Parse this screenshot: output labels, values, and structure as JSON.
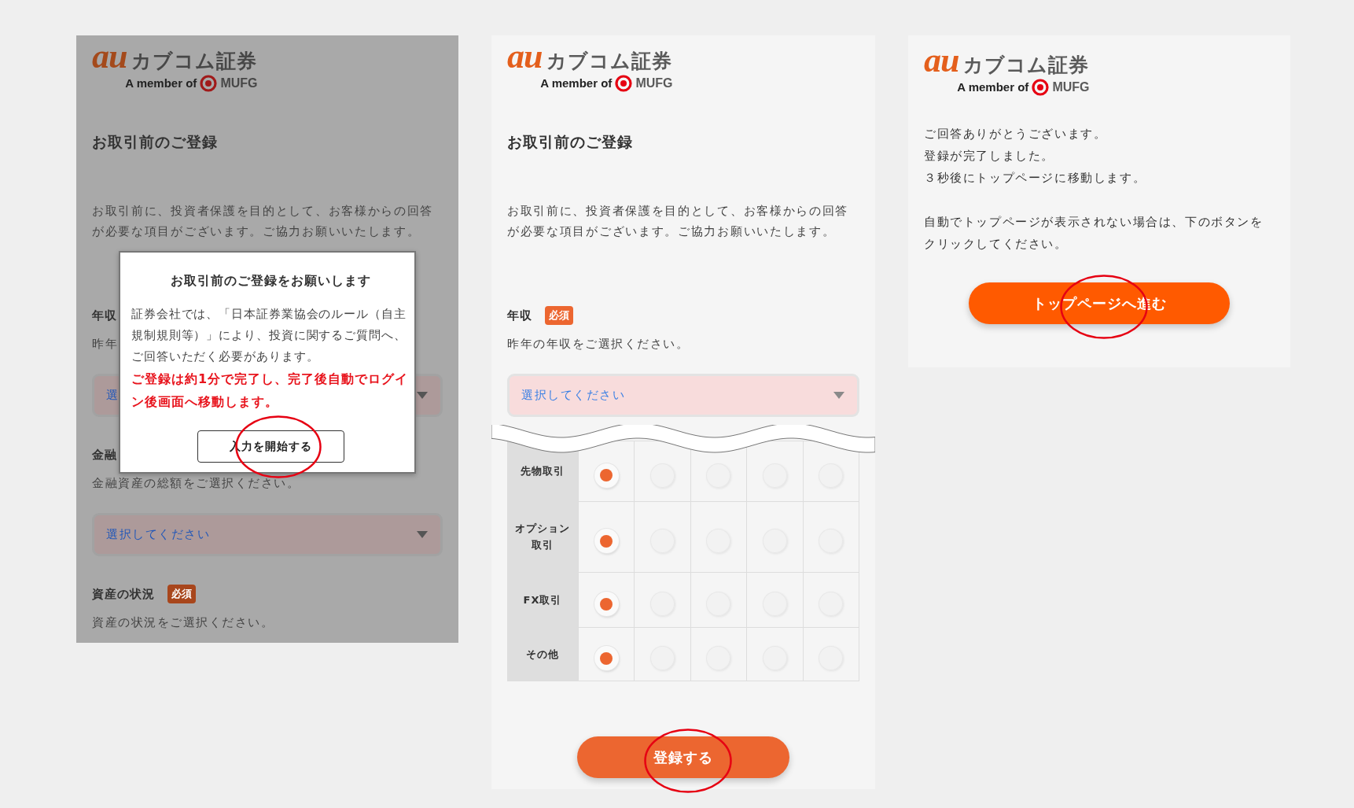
{
  "panels": [
    {
      "kind": "form",
      "dimmed": true,
      "logo": {
        "brand": "au",
        "name": "カブコム証券",
        "tagline": "A member of",
        "group": "MUFG"
      },
      "title": "お取引前のご登録",
      "description": "お取引前に、投資者保護を目的として、お客様からの回答が必要な項目がございます。ご協力お願いいたします。",
      "fields": [
        {
          "label": "年収",
          "hint": "昨年",
          "select": {
            "placeholder": "選"
          }
        },
        {
          "label": "金融",
          "hint": "金融資産の総額をご選択ください。",
          "select": {
            "placeholder": "選択してください"
          }
        },
        {
          "label": "資産の状況",
          "badge": "必須",
          "hint": "資産の状況をご選択ください。"
        }
      ],
      "dialog": {
        "title": "お取引前のご登録をお願いします",
        "body": "証券会社では、「日本証券業協会のルール（自主規制規則等）」により、投資に関するご質問へ、ご回答いただく必要があります。",
        "notice": "ご登録は約1分で完了し、完了後自動でログイン後画面へ移動します。",
        "button": {
          "label": "入力を開始する",
          "circled": true
        }
      }
    },
    {
      "kind": "form",
      "dimmed": false,
      "logo": {
        "brand": "au",
        "name": "カブコム証券",
        "tagline": "A member of",
        "group": "MUFG"
      },
      "title": "お取引前のご登録",
      "description": "お取引前に、投資者保護を目的として、お客様からの回答が必要な項目がございます。ご協力お願いいたします。",
      "fields": [
        {
          "label": "年収",
          "badge": "必須",
          "hint": "昨年の年収をご選択ください。",
          "select": {
            "placeholder": "選択してください"
          }
        }
      ],
      "matrix": {
        "rows": [
          {
            "label": "先物取引",
            "choices": [
              {
                "selected": true
              },
              {
                "selected": false
              },
              {
                "selected": false
              },
              {
                "selected": false
              },
              {
                "selected": false
              }
            ]
          },
          {
            "label": "オプション取引",
            "choices": [
              {
                "selected": true
              },
              {
                "selected": false
              },
              {
                "selected": false
              },
              {
                "selected": false
              },
              {
                "selected": false
              }
            ]
          },
          {
            "label": "FX取引",
            "choices": [
              {
                "selected": true
              },
              {
                "selected": false
              },
              {
                "selected": false
              },
              {
                "selected": false
              },
              {
                "selected": false
              }
            ]
          },
          {
            "label": "その他",
            "choices": [
              {
                "selected": true
              },
              {
                "selected": false
              },
              {
                "selected": false
              },
              {
                "selected": false
              },
              {
                "selected": false
              }
            ]
          }
        ]
      },
      "button": {
        "label": "登録する",
        "circled": true
      }
    },
    {
      "kind": "complete",
      "logo": {
        "brand": "au",
        "name": "カブコム証券",
        "tagline": "A member of",
        "group": "MUFG"
      },
      "paragraphs": [
        {
          "lines": [
            "ご回答ありがとうございます。",
            "登録が完了しました。",
            "３秒後にトップページに移動します。"
          ]
        },
        {
          "lines": [
            "自動でトップページが表示されない場合は、下のボタンをクリックしてください。"
          ]
        }
      ],
      "button": {
        "label": "トップページへ進む",
        "circled": true
      }
    }
  ]
}
